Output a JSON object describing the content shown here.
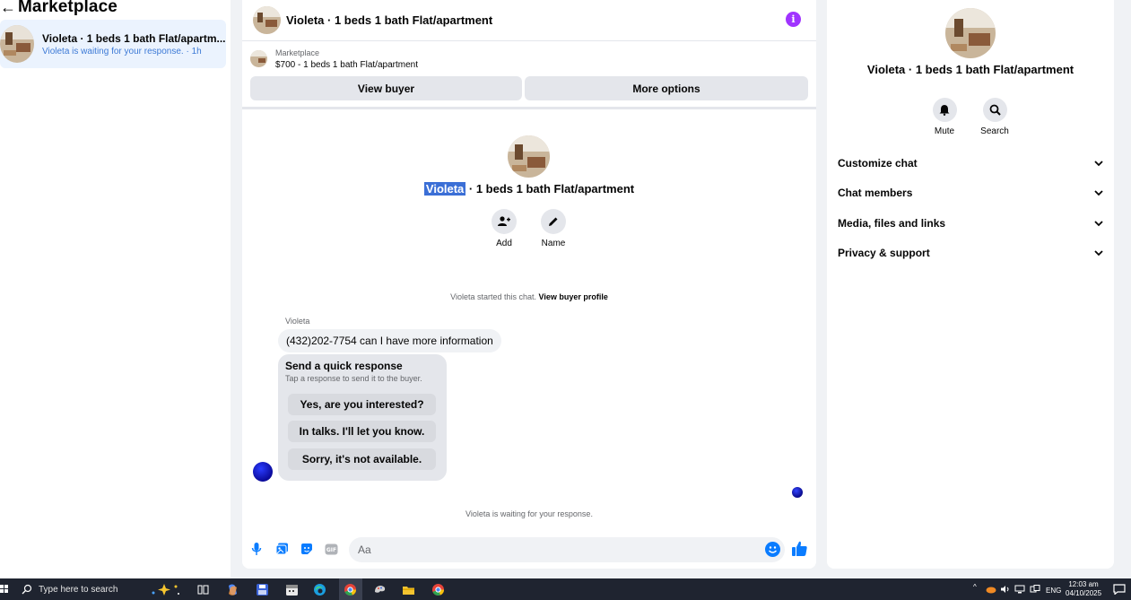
{
  "left": {
    "back_glyph": "←",
    "title": "Marketplace",
    "conversation": {
      "title": "Violeta · 1 beds 1 bath Flat/apartm...",
      "subtitle": "Violeta is waiting for your response. · 1h"
    }
  },
  "chat": {
    "header_title": "Violeta · 1 beds 1 bath Flat/apartment",
    "info_glyph": "i",
    "marketplace_label": "Marketplace",
    "listing_price": "$700 - 1 beds 1 bath Flat/apartment",
    "view_buyer": "View buyer",
    "more_options": "More options",
    "center_name_highlight": "Violeta",
    "center_name_rest": " · 1 beds 1 bath Flat/apartment",
    "actions": [
      {
        "label": "Add",
        "icon": "add-person-icon"
      },
      {
        "label": "Name",
        "icon": "pencil-icon"
      }
    ],
    "started_text": "Violeta started this chat.",
    "view_buyer_profile": "View buyer profile",
    "sender_name": "Violeta",
    "message": "(432)202-7754 can I have more information",
    "quick_response": {
      "title": "Send a quick response",
      "subtitle": "Tap a response to send it to the buyer.",
      "options": [
        "Yes, are you interested?",
        "In talks. I'll let you know.",
        "Sorry, it's not available."
      ]
    },
    "waiting_text": "Violeta is waiting for your response.",
    "composer_placeholder": "Aa"
  },
  "right": {
    "title": "Violeta · 1 beds 1 bath Flat/apartment",
    "mute": "Mute",
    "search": "Search",
    "sections": [
      "Customize chat",
      "Chat members",
      "Media, files and links",
      "Privacy & support"
    ]
  },
  "taskbar": {
    "search_placeholder": "Type here to search",
    "language": "ENG",
    "time": "12:03 am",
    "date": "04/10/2025"
  },
  "colors": {
    "accent": "#0a7cff",
    "info": "#a033ff",
    "highlight": "#3b6fd6",
    "selected_bg": "#ebf3fe"
  }
}
